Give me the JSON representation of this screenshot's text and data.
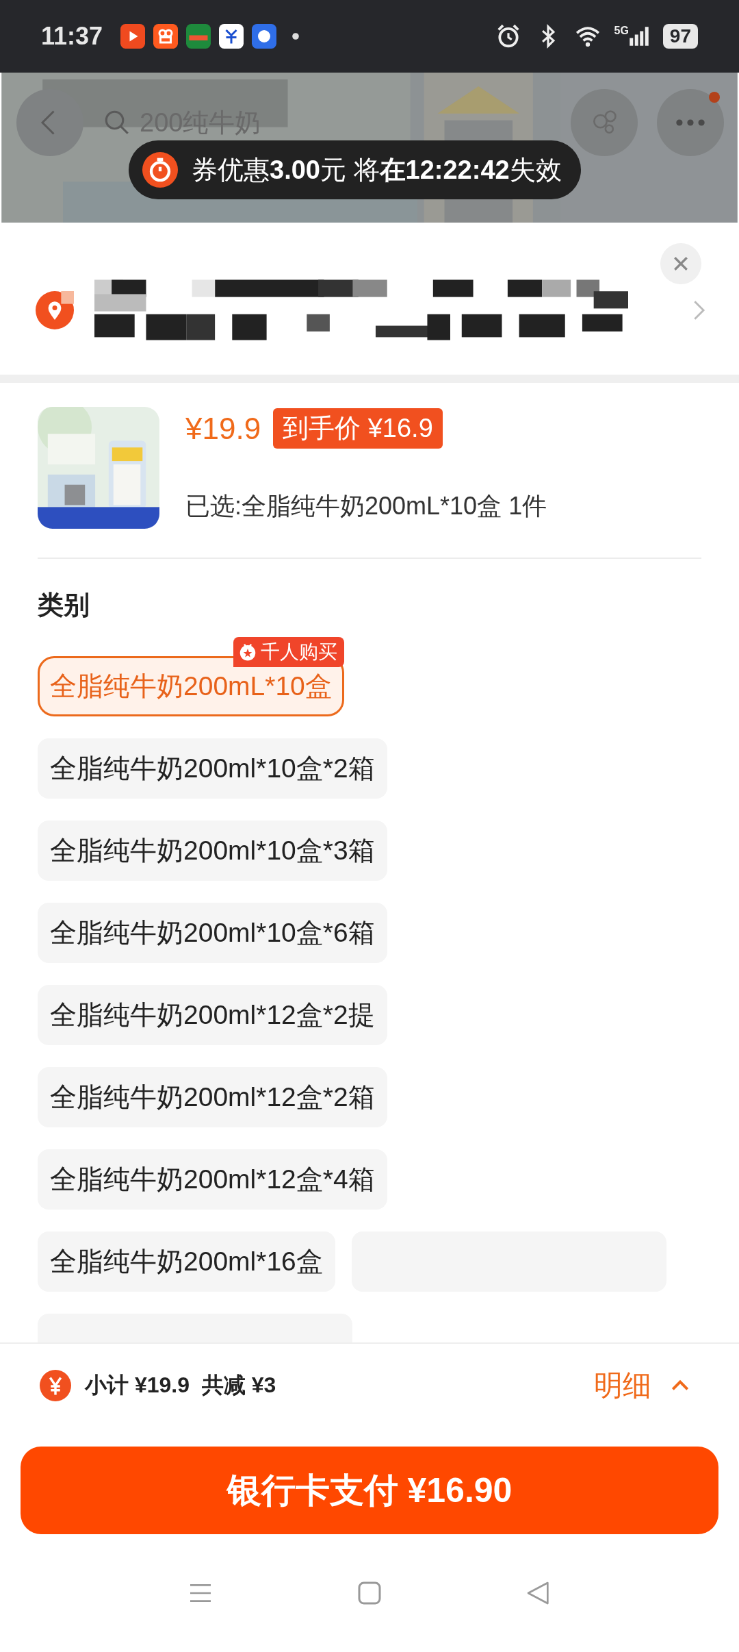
{
  "status_bar": {
    "time": "11:37",
    "network": "5G",
    "battery": "97"
  },
  "background_page": {
    "search_text": "200纯牛奶"
  },
  "coupon_toast": {
    "text": "券优惠**3.00**元 将**在12:22:42**失效"
  },
  "product": {
    "price": "¥19.9",
    "final_price": "到手价 ¥16.9",
    "selected_text": "已选:全脂纯牛奶200mL*10盒  1件"
  },
  "category": {
    "title": "类别",
    "options": [
      {
        "label": "全脂纯牛奶200mL*10盒",
        "selected": true,
        "badge": "千人购买"
      },
      {
        "label": "全脂纯牛奶200ml*10盒*2箱",
        "selected": false
      },
      {
        "label": "全脂纯牛奶200ml*10盒*3箱",
        "selected": false
      },
      {
        "label": "全脂纯牛奶200ml*10盒*6箱",
        "selected": false
      },
      {
        "label": "全脂纯牛奶200ml*12盒*2提",
        "selected": false
      },
      {
        "label": "全脂纯牛奶200ml*12盒*2箱",
        "selected": false
      },
      {
        "label": "全脂纯牛奶200ml*12盒*4箱",
        "selected": false
      },
      {
        "label": "全脂纯牛奶200ml*16盒",
        "selected": false
      },
      {
        "selected": false
      },
      {
        "selected": false
      }
    ]
  },
  "footer": {
    "summary": "小计 ¥19.9  共减 ¥3",
    "details": "明细",
    "pay_button": "银行卡支付 ¥16.90"
  }
}
